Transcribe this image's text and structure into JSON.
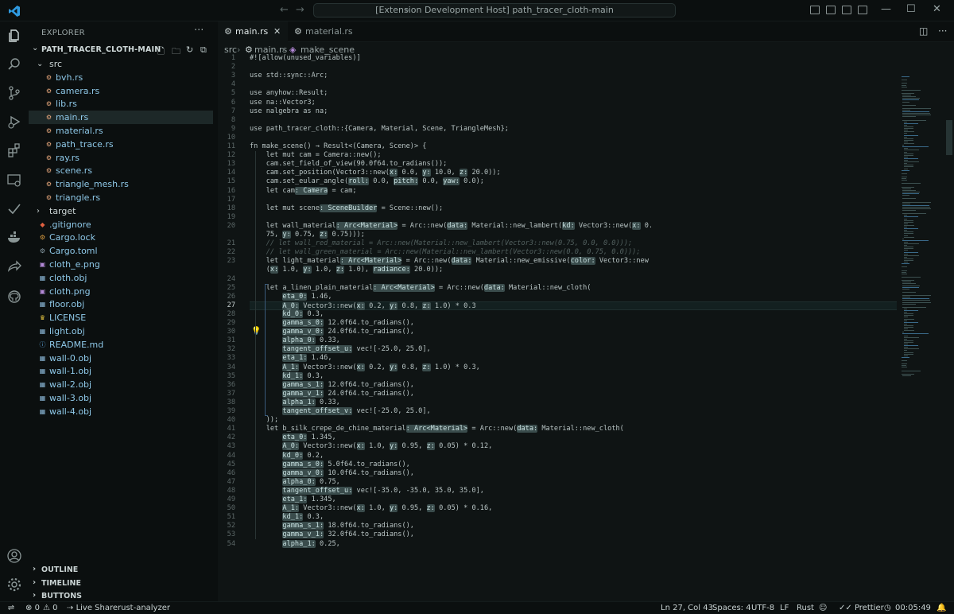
{
  "window": {
    "title": "[Extension Development Host] path_tracer_cloth-main",
    "search_icon": "search-icon"
  },
  "sidebar": {
    "title": "EXPLORER",
    "folder": "PATH_TRACER_CLOTH-MAIN",
    "tree": [
      {
        "label": "src",
        "kind": "folder-open",
        "depth": 1
      },
      {
        "label": "bvh.rs",
        "kind": "rust",
        "depth": 2
      },
      {
        "label": "camera.rs",
        "kind": "rust",
        "depth": 2
      },
      {
        "label": "lib.rs",
        "kind": "rust",
        "depth": 2
      },
      {
        "label": "main.rs",
        "kind": "rust",
        "depth": 2,
        "selected": true
      },
      {
        "label": "material.rs",
        "kind": "rust",
        "depth": 2
      },
      {
        "label": "path_trace.rs",
        "kind": "rust",
        "depth": 2
      },
      {
        "label": "ray.rs",
        "kind": "rust",
        "depth": 2
      },
      {
        "label": "scene.rs",
        "kind": "rust",
        "depth": 2
      },
      {
        "label": "triangle_mesh.rs",
        "kind": "rust",
        "depth": 2
      },
      {
        "label": "triangle.rs",
        "kind": "rust",
        "depth": 2
      },
      {
        "label": "target",
        "kind": "folder-closed",
        "depth": 1
      },
      {
        "label": ".gitignore",
        "kind": "git",
        "depth": 1
      },
      {
        "label": "Cargo.lock",
        "kind": "lock",
        "depth": 1
      },
      {
        "label": "Cargo.toml",
        "kind": "gear",
        "depth": 1
      },
      {
        "label": "cloth_e.png",
        "kind": "image",
        "depth": 1
      },
      {
        "label": "cloth.obj",
        "kind": "obj",
        "depth": 1
      },
      {
        "label": "cloth.png",
        "kind": "image",
        "depth": 1
      },
      {
        "label": "floor.obj",
        "kind": "obj",
        "depth": 1
      },
      {
        "label": "LICENSE",
        "kind": "license",
        "depth": 1
      },
      {
        "label": "light.obj",
        "kind": "obj",
        "depth": 1
      },
      {
        "label": "README.md",
        "kind": "markdown",
        "depth": 1
      },
      {
        "label": "wall-0.obj",
        "kind": "obj",
        "depth": 1
      },
      {
        "label": "wall-1.obj",
        "kind": "obj",
        "depth": 1
      },
      {
        "label": "wall-2.obj",
        "kind": "obj",
        "depth": 1
      },
      {
        "label": "wall-3.obj",
        "kind": "obj",
        "depth": 1
      },
      {
        "label": "wall-4.obj",
        "kind": "obj",
        "depth": 1
      }
    ],
    "bottom_sections": [
      "OUTLINE",
      "TIMELINE",
      "BUTTONS"
    ]
  },
  "tabs": [
    {
      "label": "main.rs",
      "active": true
    },
    {
      "label": "material.rs",
      "active": false
    }
  ],
  "breadcrumb": {
    "folder": "src",
    "file": "main.rs",
    "symbol": "make_scene"
  },
  "editor": {
    "line_numbers": [
      "1",
      "2",
      "3",
      "4",
      "5",
      "6",
      "7",
      "8",
      "9",
      "10",
      "11",
      "12",
      "13",
      "14",
      "15",
      "16",
      "17",
      "18",
      "19",
      "20",
      "",
      "21",
      "22",
      "23",
      "",
      "24",
      "25",
      "26",
      "27",
      "28",
      "29",
      "30",
      "31",
      "32",
      "33",
      "34",
      "35",
      "36",
      "37",
      "38",
      "39",
      "40",
      "41",
      "42",
      "43",
      "44",
      "45",
      "46",
      "47",
      "48",
      "49",
      "50",
      "51",
      "52",
      "53",
      "54"
    ],
    "current_line": "27",
    "lines": [
      "#![allow(unused_variables)]",
      "",
      "use std::sync::Arc;",
      "",
      "use anyhow::Result;",
      "use na::Vector3;",
      "use nalgebra as na;",
      "",
      "use path_tracer_cloth::{Camera, Material, Scene, TriangleMesh};",
      "",
      "fn make_scene() → Result<(Camera, Scene)> {",
      "    let mut cam = Camera::new();",
      "    cam.set_field_of_view(90.0f64.to_radians());",
      "    cam.set_position(Vector3::new(x: 0.0, y: 10.0, z: 20.0));",
      "    cam.set_eular_angle(roll: 0.0, pitch: 0.0, yaw: 0.0);",
      "    let cam: Camera = cam;",
      "",
      "    let mut scene: SceneBuilder = Scene::new();",
      "",
      "    let wall_material: Arc<Material> = Arc::new(data: Material::new_lambert(kd: Vector3::new(x: 0.",
      "    75, y: 0.75, z: 0.75)));",
      "    // let wall_red_material = Arc::new(Material::new_lambert(Vector3::new(0.75, 0.0, 0.0)));",
      "    // let wall_green_material = Arc::new(Material::new_lambert(Vector3::new(0.0, 0.75, 0.0)));",
      "    let light_material: Arc<Material> = Arc::new(data: Material::new_emissive(color: Vector3::new",
      "    (x: 1.0, y: 1.0, z: 1.0), radiance: 20.0));",
      "",
      "    let a_linen_plain_material: Arc<Material> = Arc::new(data: Material::new_cloth(",
      "        eta_0: 1.46,",
      "        A_0: Vector3::new(x: 0.2, y: 0.8, z: 1.0) * 0.3",
      "        kd_0: 0.3,",
      "        gamma_s_0: 12.0f64.to_radians(),",
      "        gamma_v_0: 24.0f64.to_radians(),",
      "        alpha_0: 0.33,",
      "        tangent_offset_u: vec![-25.0, 25.0],",
      "        eta_1: 1.46,",
      "        A_1: Vector3::new(x: 0.2, y: 0.8, z: 1.0) * 0.3,",
      "        kd_1: 0.3,",
      "        gamma_s_1: 12.0f64.to_radians(),",
      "        gamma_v_1: 24.0f64.to_radians(),",
      "        alpha_1: 0.33,",
      "        tangent_offset_v: vec![-25.0, 25.0],",
      "    ));",
      "    let b_silk_crepe_de_chine_material: Arc<Material> = Arc::new(data: Material::new_cloth(",
      "        eta_0: 1.345,",
      "        A_0: Vector3::new(x: 1.0, y: 0.95, z: 0.05) * 0.12,",
      "        kd_0: 0.2,",
      "        gamma_s_0: 5.0f64.to_radians(),",
      "        gamma_v_0: 10.0f64.to_radians(),",
      "        alpha_0: 0.75,",
      "        tangent_offset_u: vec![-35.0, -35.0, 35.0, 35.0],",
      "        eta_1: 1.345,",
      "        A_1: Vector3::new(x: 1.0, y: 0.95, z: 0.05) * 0.16,",
      "        kd_1: 0.3,",
      "        gamma_s_1: 18.0f64.to_radians(),",
      "        gamma_v_1: 32.0f64.to_radians(),",
      "        alpha_1: 0.25,"
    ]
  },
  "statusbar": {
    "errors": "0",
    "warnings": "0",
    "live_share": "Live Share",
    "language_server": "rust-analyzer",
    "cursor": "Ln 27, Col 43",
    "spaces": "Spaces: 4",
    "encoding": "UTF-8",
    "eol": "LF",
    "language": "Rust",
    "formatter": "Prettier",
    "clock": "00:05:49"
  },
  "colors": {
    "background": "#0f1414",
    "sidebar": "#0b0f0f",
    "hint_bg": "#3a4c4c",
    "rust_icon": "#e8a87c",
    "file_text": "#8ec8e8"
  }
}
